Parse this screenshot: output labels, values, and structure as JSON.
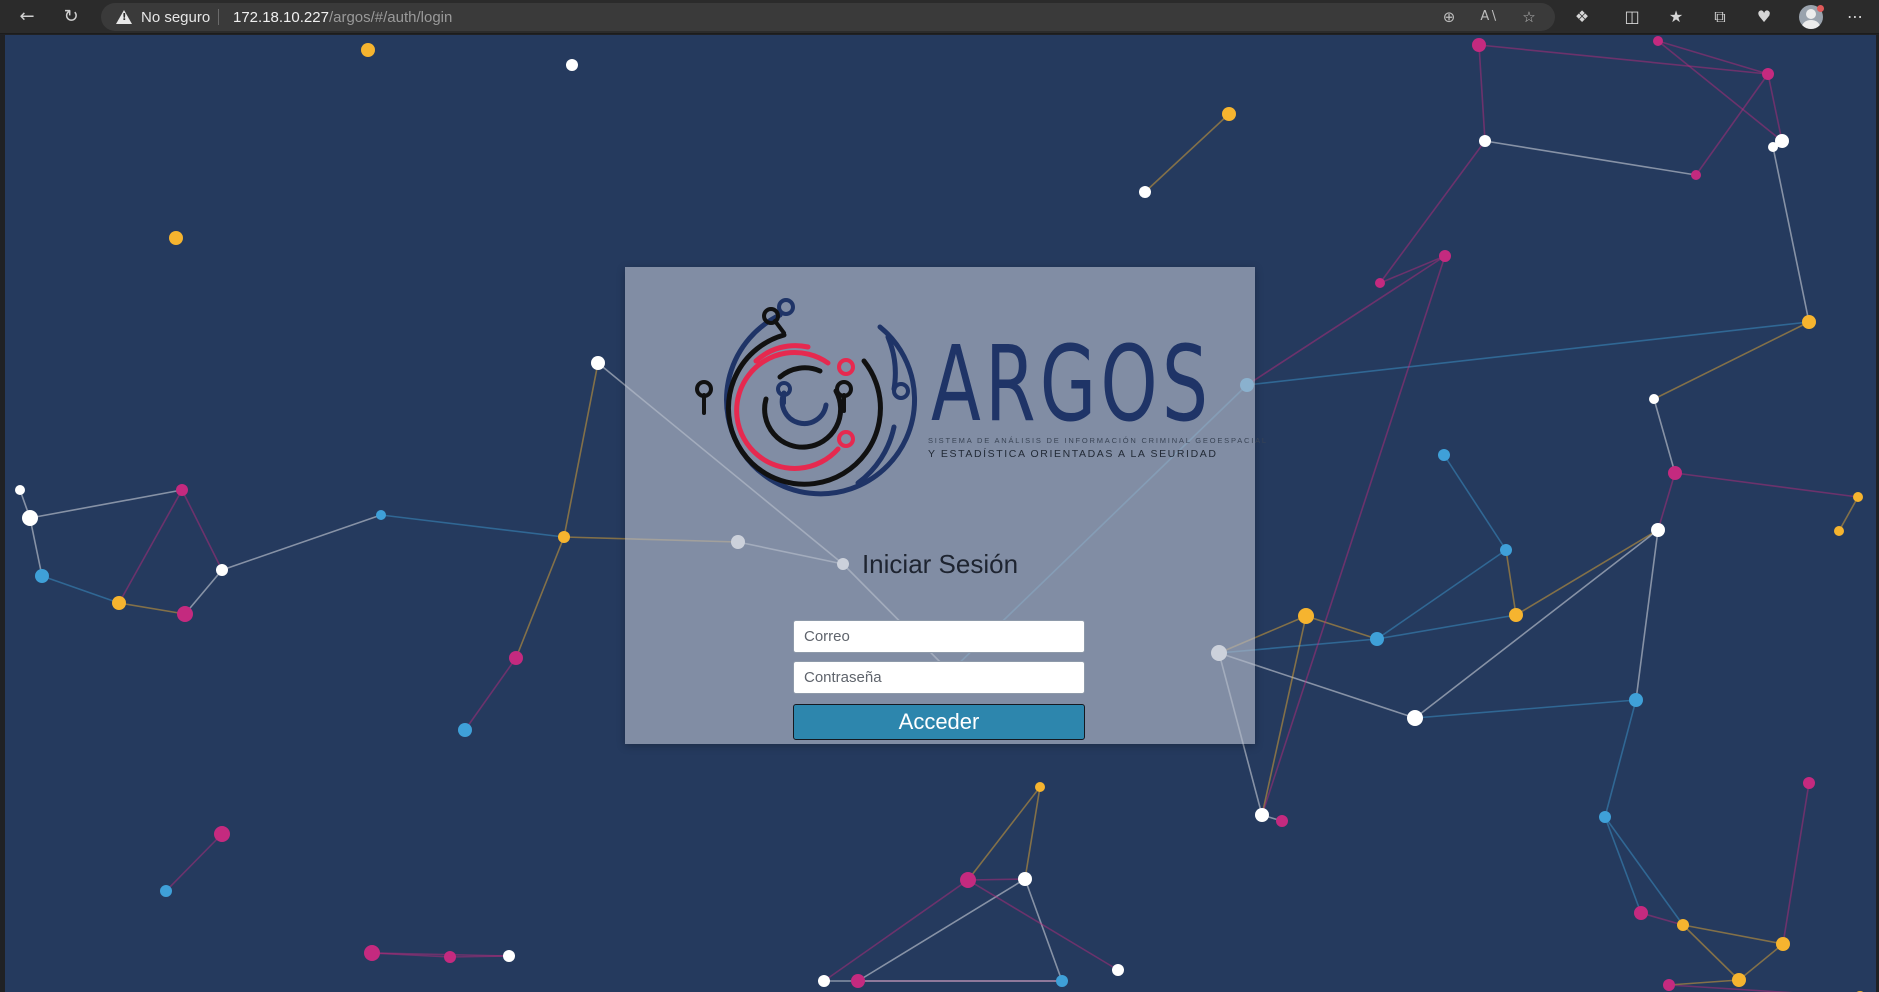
{
  "browser": {
    "security_label": "No seguro",
    "url_host": "172.18.10.227",
    "url_path": "/argos/#/auth/login",
    "icons": {
      "back": "back-arrow-icon",
      "refresh": "refresh-icon",
      "warning": "warning-triangle-icon",
      "zoom": "zoom-out-icon",
      "read_aloud": "read-aloud-icon",
      "favorite": "star-icon",
      "extensions": "extensions-icon",
      "split": "split-screen-icon",
      "favorites": "favorites-icon",
      "collections": "collections-icon",
      "health": "heartbeat-icon",
      "profile": "profile-avatar",
      "menu": "more-menu-icon"
    }
  },
  "login": {
    "brand": "ARGOS",
    "tagline_1": "SISTEMA DE ANÁLISIS DE INFORMACIÓN CRIMINAL GEOESPACIAL",
    "tagline_2": "Y ESTADÍSTICA ORIENTADAS A LA SEURIDAD",
    "title": "Iniciar Sesión",
    "email_placeholder": "Correo",
    "password_placeholder": "Contraseña",
    "submit_label": "Acceder"
  },
  "colors": {
    "background": "#253a5e",
    "node_white": "#ffffff",
    "node_yellow": "#f6b42f",
    "node_pink": "#c42a7f",
    "node_blue": "#3fa0d8",
    "logo_navy": "#1f3467",
    "logo_red": "#e6294f",
    "button": "#2d86ad"
  }
}
